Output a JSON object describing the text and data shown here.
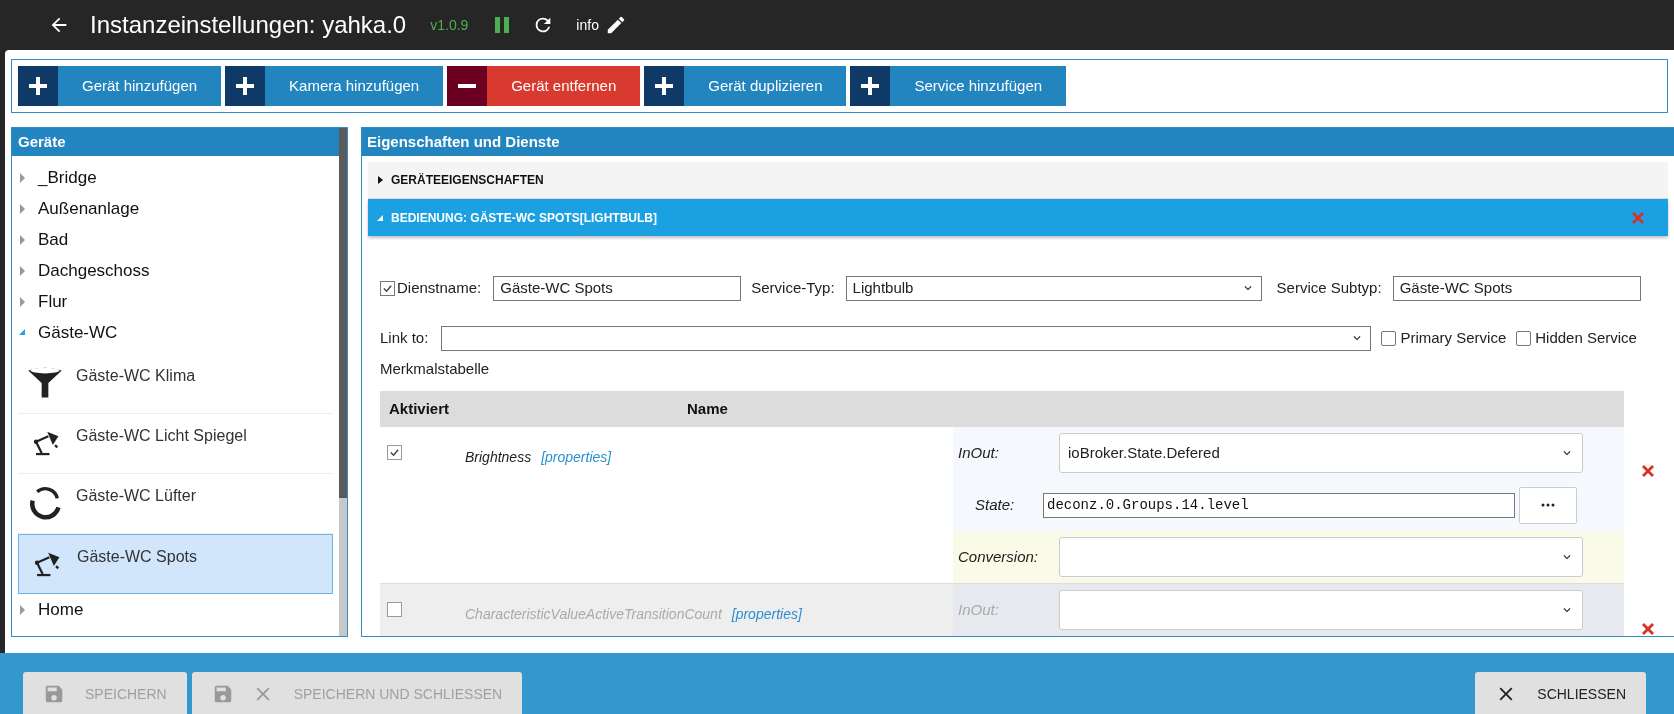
{
  "header": {
    "title": "Instanzeinstellungen: yahka.0",
    "version": "v1.0.9",
    "info": "info"
  },
  "toolbar": [
    {
      "label": "Gerät hinzufügen",
      "kind": "add"
    },
    {
      "label": "Kamera hinzufügen",
      "kind": "add"
    },
    {
      "label": "Gerät entfernen",
      "kind": "remove"
    },
    {
      "label": "Gerät duplizieren",
      "kind": "add"
    },
    {
      "label": "Service hinzufügen",
      "kind": "add"
    }
  ],
  "devices": {
    "title": "Geräte",
    "items": [
      {
        "label": "_Bridge",
        "expanded": false
      },
      {
        "label": "Außenanlage",
        "expanded": false
      },
      {
        "label": "Bad",
        "expanded": false
      },
      {
        "label": "Dachgeschoss",
        "expanded": false
      },
      {
        "label": "Flur",
        "expanded": false
      },
      {
        "label": "Gäste-WC",
        "expanded": true,
        "children": [
          {
            "label": "Gäste-WC Klima",
            "kind": "funnel",
            "selected": false
          },
          {
            "label": "Gäste-WC Licht Spiegel",
            "kind": "lamp",
            "selected": false
          },
          {
            "label": "Gäste-WC Lüfter",
            "kind": "ring",
            "selected": false
          },
          {
            "label": "Gäste-WC Spots",
            "kind": "lamp",
            "selected": true
          }
        ]
      },
      {
        "label": "Home",
        "expanded": false
      }
    ]
  },
  "properties": {
    "title": "Eigenschaften und Dienste",
    "sections": [
      {
        "label": "GERÄTEEIGENSCHAFTEN",
        "expanded": false
      },
      {
        "label": "BEDIENUNG: GÄSTE-WC SPOTS[LIGHTBULB]",
        "expanded": true
      }
    ],
    "service": {
      "enabled": true,
      "name_label": "Dienstname:",
      "name_value": "Gäste-WC Spots",
      "type_label": "Service-Typ:",
      "type_value": "Lightbulb",
      "subtype_label": "Service Subtyp:",
      "subtype_value": "Gäste-WC Spots",
      "link_label": "Link to:",
      "options": [
        {
          "label": "Primary Service",
          "checked": false
        },
        {
          "label": "Hidden Service",
          "checked": false
        }
      ]
    },
    "table": {
      "title": "Merkmalstabelle",
      "columns": [
        "Aktiviert",
        "Name"
      ],
      "rows": [
        {
          "checked": true,
          "name": "Brightness",
          "link": "[properties]",
          "fields": [
            {
              "label": "InOut:",
              "kind": "select",
              "value": "ioBroker.State.Defered",
              "highlighted": false
            },
            {
              "label": "State:",
              "kind": "text",
              "value": "deconz.0.Groups.14.level",
              "highlighted": false
            },
            {
              "label": "Conversion:",
              "kind": "select",
              "highlighted": true
            }
          ]
        },
        {
          "checked": false,
          "name": "CharacteristicValueActiveTransitionCount",
          "link": "[properties]",
          "fields": [
            {
              "label": "InOut:",
              "kind": "select",
              "highlighted": false
            }
          ]
        }
      ]
    }
  },
  "footer": [
    {
      "label": "SPEICHERN",
      "kind": "save",
      "disabled": true
    },
    {
      "label": "SPEICHERN UND SCHLIESSEN",
      "kind": "save_close",
      "disabled": true
    },
    {
      "label": "SCHLIESSEN",
      "kind": "close",
      "disabled": false
    }
  ]
}
